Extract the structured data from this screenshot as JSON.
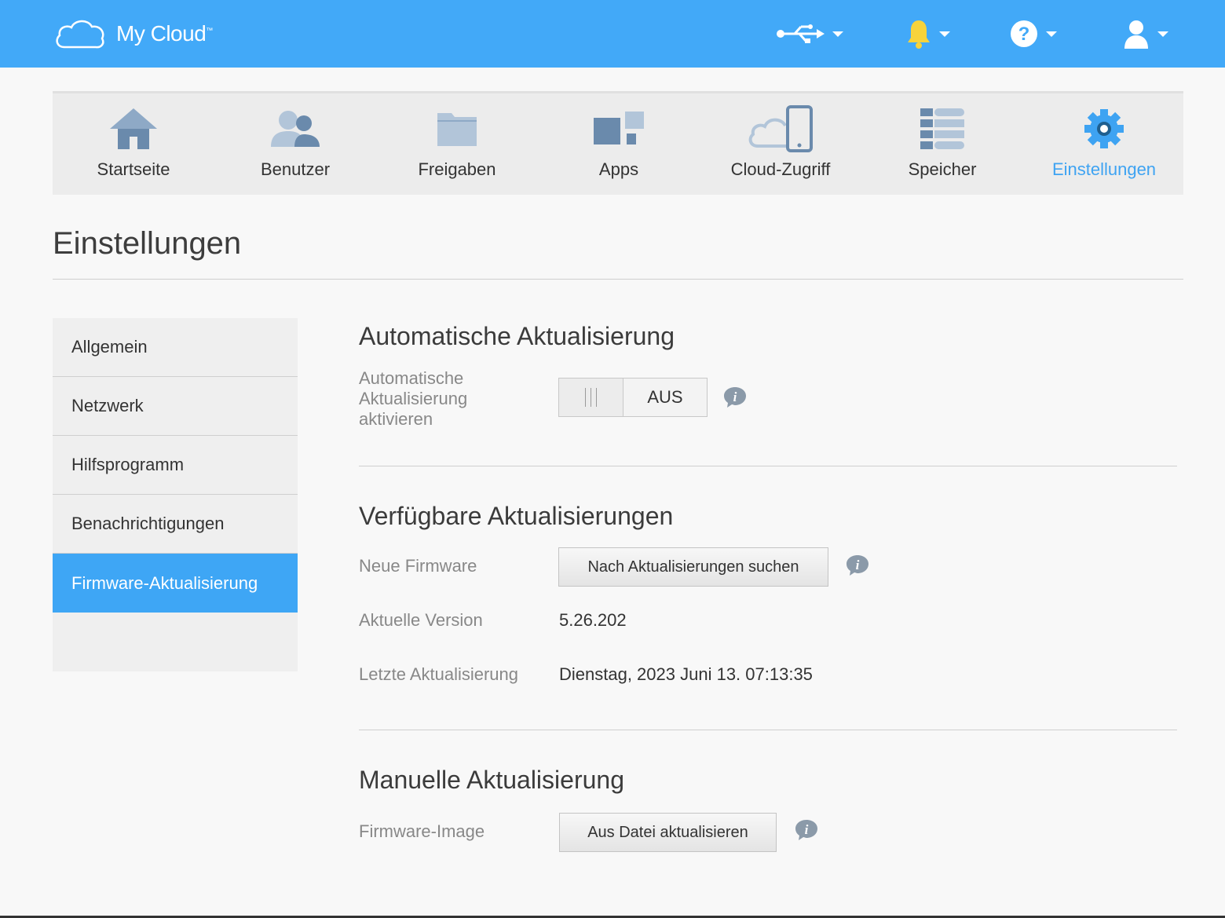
{
  "app": {
    "logo_text": "My Cloud",
    "trademark": "™"
  },
  "topbar": {
    "icons": [
      "usb-icon",
      "bell-icon",
      "help-icon",
      "user-icon"
    ],
    "colors": {
      "bar": "#42a9f8",
      "bell": "#f7d33b"
    }
  },
  "nav": {
    "items": [
      {
        "label": "Startseite",
        "icon": "home-icon"
      },
      {
        "label": "Benutzer",
        "icon": "users-icon"
      },
      {
        "label": "Freigaben",
        "icon": "folder-icon"
      },
      {
        "label": "Apps",
        "icon": "apps-icon"
      },
      {
        "label": "Cloud-Zugriff",
        "icon": "cloud-device-icon"
      },
      {
        "label": "Speicher",
        "icon": "storage-icon"
      },
      {
        "label": "Einstellungen",
        "icon": "gear-icon"
      }
    ],
    "active": "Einstellungen",
    "accent": "#3ea3f2"
  },
  "page": {
    "title": "Einstellungen"
  },
  "sidebar": {
    "items": [
      {
        "label": "Allgemein"
      },
      {
        "label": "Netzwerk"
      },
      {
        "label": "Hilfsprogramm"
      },
      {
        "label": "Benachrichtigungen"
      },
      {
        "label": "Firmware-Aktualisierung"
      }
    ],
    "active": "Firmware-Aktualisierung"
  },
  "auto_update": {
    "heading": "Automatische Aktualisierung",
    "label_line1": "Automatische",
    "label_line2": "Aktualisierung",
    "label_line3": "aktivieren",
    "toggle_state": "AUS"
  },
  "available": {
    "heading": "Verfügbare Aktualisierungen",
    "new_firmware_label": "Neue Firmware",
    "check_button": "Nach Aktualisierungen suchen",
    "current_version_label": "Aktuelle Version",
    "current_version": "5.26.202",
    "last_update_label": "Letzte Aktualisierung",
    "last_update": "Dienstag, 2023 Juni 13. 07:13:35"
  },
  "manual": {
    "heading": "Manuelle Aktualisierung",
    "image_label": "Firmware-Image",
    "file_button": "Aus Datei aktualisieren"
  }
}
